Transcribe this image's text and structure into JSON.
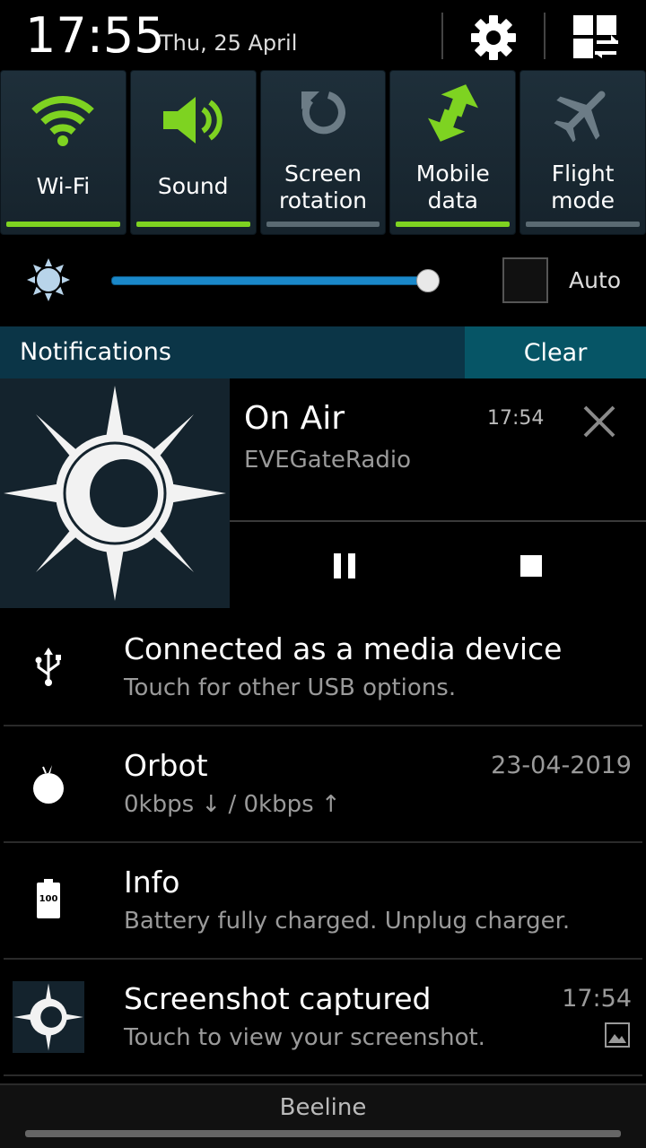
{
  "status": {
    "time": "17:55",
    "date": "Thu, 25 April"
  },
  "header_icons": [
    "gear-icon",
    "grid-edit-icon"
  ],
  "toggles": [
    {
      "label": "Wi-Fi",
      "icon": "wifi-icon",
      "state": "on"
    },
    {
      "label": "Sound",
      "icon": "speaker-icon",
      "state": "on"
    },
    {
      "label": "Screen rotation",
      "icon": "rotation-icon",
      "state": "off"
    },
    {
      "label": "Mobile data",
      "icon": "mobile-data-icon",
      "state": "on"
    },
    {
      "label": "Flight mode",
      "icon": "airplane-icon",
      "state": "off"
    }
  ],
  "brightness": {
    "level": 0.98,
    "auto_label": "Auto",
    "auto_checked": false
  },
  "notifications_bar": {
    "title": "Notifications",
    "clear_label": "Clear"
  },
  "media": {
    "title": "On Air",
    "subtitle": "EVEGateRadio",
    "time": "17:54"
  },
  "notifications": [
    {
      "title": "Connected as a media device",
      "subtitle": "Touch for other USB options.",
      "time": "",
      "icon": "usb-icon"
    },
    {
      "title": "Orbot",
      "subtitle": "0kbps ↓ / 0kbps ↑",
      "time": "23-04-2019",
      "icon": "onion-icon"
    },
    {
      "title": "Info",
      "subtitle": "Battery fully charged. Unplug charger.",
      "time": "",
      "icon": "battery-icon",
      "icon_text": "100"
    },
    {
      "title": "Screenshot captured",
      "subtitle": "Touch to view your screenshot.",
      "time": "17:54",
      "icon": "screenshot-thumbnail"
    }
  ],
  "footer": {
    "carrier": "Beeline"
  },
  "colors": {
    "accent_green": "#7ed321",
    "bar_blue": "#0b3547",
    "clear_teal": "#065566",
    "slider_blue": "#1a88c9"
  }
}
